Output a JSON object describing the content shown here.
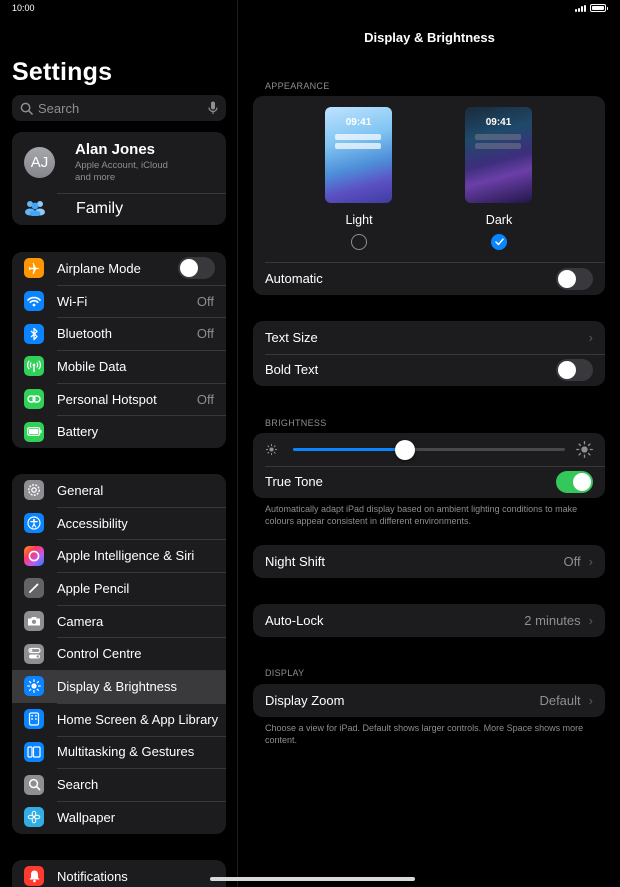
{
  "status_bar": {
    "time": "10:00"
  },
  "sidebar": {
    "title": "Settings",
    "search_placeholder": "Search",
    "profile": {
      "initials": "AJ",
      "name": "Alan Jones",
      "subtitle_line1": "Apple Account, iCloud",
      "subtitle_line2": "and more"
    },
    "family_label": "Family",
    "connectivity": [
      {
        "label": "Airplane Mode",
        "value": "",
        "icon": "airplane-icon",
        "color": "#ff9500"
      },
      {
        "label": "Wi-Fi",
        "value": "Off",
        "icon": "wifi-icon",
        "color": "#0a84ff"
      },
      {
        "label": "Bluetooth",
        "value": "Off",
        "icon": "bluetooth-icon",
        "color": "#0a84ff"
      },
      {
        "label": "Mobile Data",
        "value": "",
        "icon": "antenna-icon",
        "color": "#30d158"
      },
      {
        "label": "Personal Hotspot",
        "value": "Off",
        "icon": "hotspot-icon",
        "color": "#30d158"
      },
      {
        "label": "Battery",
        "value": "",
        "icon": "battery-icon",
        "color": "#30d158"
      }
    ],
    "system": [
      {
        "label": "General",
        "icon": "gear-icon",
        "color": "#8e8e93"
      },
      {
        "label": "Accessibility",
        "icon": "accessibility-icon",
        "color": "#0a84ff"
      },
      {
        "label": "Apple Intelligence & Siri",
        "icon": "siri-icon",
        "color": "#d95cf0"
      },
      {
        "label": "Apple Pencil",
        "icon": "pencil-icon",
        "color": "#636366"
      },
      {
        "label": "Camera",
        "icon": "camera-icon",
        "color": "#8e8e93"
      },
      {
        "label": "Control Centre",
        "icon": "control-centre-icon",
        "color": "#8e8e93"
      },
      {
        "label": "Display & Brightness",
        "icon": "sun-icon",
        "color": "#0a84ff"
      },
      {
        "label": "Home Screen & App Library",
        "icon": "home-screen-icon",
        "color": "#0a84ff"
      },
      {
        "label": "Multitasking & Gestures",
        "icon": "multitasking-icon",
        "color": "#0a84ff"
      },
      {
        "label": "Search",
        "icon": "magnifier-icon",
        "color": "#8e8e93"
      },
      {
        "label": "Wallpaper",
        "icon": "flower-icon",
        "color": "#32ade6"
      }
    ],
    "notifications_label": "Notifications"
  },
  "detail": {
    "title": "Display & Brightness",
    "appearance_label": "APPEARANCE",
    "phone_time": "09:41",
    "light_label": "Light",
    "dark_label": "Dark",
    "selected_appearance": "Dark",
    "automatic_label": "Automatic",
    "automatic_on": false,
    "text_size_label": "Text Size",
    "bold_text_label": "Bold Text",
    "bold_text_on": false,
    "brightness_label": "BRIGHTNESS",
    "brightness_level": 0.41,
    "true_tone_label": "True Tone",
    "true_tone_on": true,
    "true_tone_note": "Automatically adapt iPad display based on ambient lighting conditions to make colours appear consistent in different environments.",
    "night_shift_label": "Night Shift",
    "night_shift_value": "Off",
    "auto_lock_label": "Auto-Lock",
    "auto_lock_value": "2 minutes",
    "display_label": "DISPLAY",
    "display_zoom_label": "Display Zoom",
    "display_zoom_value": "Default",
    "display_zoom_note": "Choose a view for iPad. Default shows larger controls. More Space shows more content."
  }
}
